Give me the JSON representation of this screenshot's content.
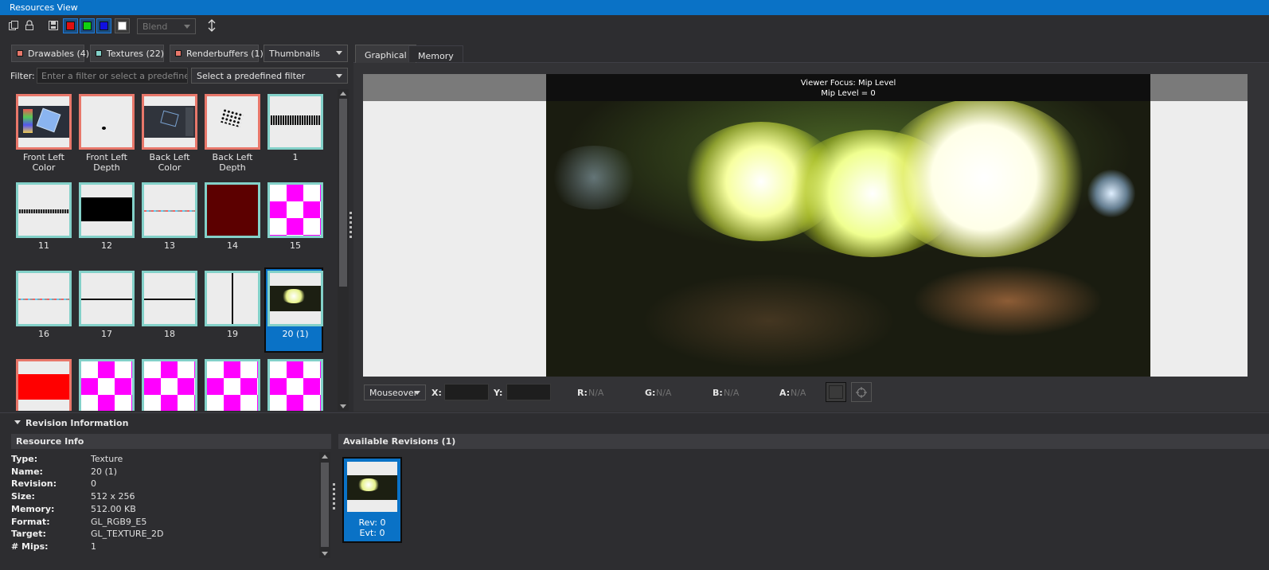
{
  "window": {
    "title": "Resources View"
  },
  "toolbar": {
    "blend_placeholder": "Blend",
    "icons": [
      "new-window-icon",
      "lock-icon",
      "save-icon",
      "red-channel-icon",
      "green-channel-icon",
      "blue-channel-icon",
      "alpha-channel-icon",
      "flip-vertical-icon"
    ],
    "channel_colors": {
      "red": "#e11010",
      "green": "#10d010",
      "blue": "#1010e0",
      "alpha": "#ffffff"
    }
  },
  "categories": [
    {
      "label": "Drawables (4)",
      "color": "#e8776a"
    },
    {
      "label": "Textures (22)",
      "color": "#83d1c9"
    },
    {
      "label": "Renderbuffers (1)",
      "color": "#e8776a"
    }
  ],
  "view_mode": "Thumbnails",
  "filter": {
    "label": "Filter:",
    "placeholder": "Enter a filter or select a predefined one",
    "predefined": "Select a predefined filter"
  },
  "thumbnails": [
    {
      "label": "Front Left Color",
      "kind": "drawable",
      "content": "screenshot-cube"
    },
    {
      "label": "Front Left Depth",
      "kind": "drawable",
      "content": "depth-dot"
    },
    {
      "label": "Back Left Color",
      "kind": "drawable",
      "content": "screenshot-dark"
    },
    {
      "label": "Back Left Depth",
      "kind": "drawable",
      "content": "depth-scatter"
    },
    {
      "label": "1",
      "kind": "texture",
      "content": "text-strip"
    },
    {
      "label": "11",
      "kind": "texture",
      "content": "thin-strip"
    },
    {
      "label": "12",
      "kind": "texture",
      "content": "noise-strip"
    },
    {
      "label": "13",
      "kind": "texture",
      "content": "color-line"
    },
    {
      "label": "14",
      "kind": "texture",
      "content": "solid-darkred"
    },
    {
      "label": "15",
      "kind": "texture",
      "content": "checker"
    },
    {
      "label": "16",
      "kind": "texture",
      "content": "color-line"
    },
    {
      "label": "17",
      "kind": "texture",
      "content": "black-line"
    },
    {
      "label": "18",
      "kind": "texture",
      "content": "black-line"
    },
    {
      "label": "19",
      "kind": "texture",
      "content": "vertical-line"
    },
    {
      "label": "20 (1)",
      "kind": "texture",
      "content": "photo",
      "selected": true
    },
    {
      "label": "",
      "kind": "drawable",
      "content": "solid-red"
    },
    {
      "label": "",
      "kind": "texture",
      "content": "checker"
    },
    {
      "label": "",
      "kind": "texture",
      "content": "checker"
    },
    {
      "label": "",
      "kind": "texture",
      "content": "checker"
    },
    {
      "label": "",
      "kind": "texture",
      "content": "checker"
    }
  ],
  "viewer": {
    "tabs": [
      {
        "label": "Graphical",
        "active": true
      },
      {
        "label": "Memory",
        "active": false
      }
    ],
    "overlay_line1": "Viewer Focus: Mip Level",
    "overlay_line2": "Mip Level = 0",
    "pixel": {
      "mode": "Mouseover",
      "x_label": "X:",
      "y_label": "Y:",
      "r_label": "R:",
      "r_value": "N/A",
      "g_label": "G:",
      "g_value": "N/A",
      "b_label": "B:",
      "b_value": "N/A",
      "a_label": "A:",
      "a_value": "N/A"
    }
  },
  "revision": {
    "header": "Revision Information",
    "info_header": "Resource Info",
    "fields": [
      {
        "label": "Type:",
        "value": "Texture"
      },
      {
        "label": "Name:",
        "value": "20 (1)"
      },
      {
        "label": "Revision:",
        "value": "0"
      },
      {
        "label": "Size:",
        "value": "512 x 256"
      },
      {
        "label": "Memory:",
        "value": "512.00 KB"
      },
      {
        "label": "Format:",
        "value": "GL_RGB9_E5"
      },
      {
        "label": "Target:",
        "value": "GL_TEXTURE_2D"
      },
      {
        "label": "# Mips:",
        "value": "1"
      }
    ],
    "available_header": "Available Revisions (1)",
    "items": [
      {
        "rev": "Rev: 0",
        "evt": "Evt: 0"
      }
    ]
  }
}
